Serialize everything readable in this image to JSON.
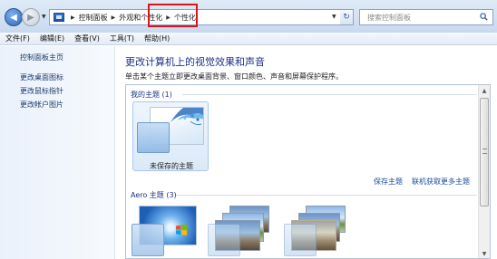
{
  "addressbar": {
    "crumbs": [
      "控制面板",
      "外观和个性化",
      "个性化"
    ],
    "search_placeholder": "搜索控制面板"
  },
  "menu": [
    "文件(F)",
    "编辑(E)",
    "查看(V)",
    "工具(T)",
    "帮助(H)"
  ],
  "leftnav": {
    "home": "控制面板主页",
    "links": [
      "更改桌面图标",
      "更改鼠标指针",
      "更改帐户图片"
    ]
  },
  "main": {
    "title": "更改计算机上的视觉效果和声音",
    "subtitle": "单击某个主题立即更改桌面背景、窗口颜色、声音和屏幕保护程序。",
    "my_themes": {
      "header": "我的主题 (1)",
      "items": [
        {
          "label": "未保存的主题"
        }
      ]
    },
    "actions": {
      "save_theme": "保存主题",
      "get_more": "联机获取更多主题"
    },
    "aero_themes": {
      "header": "Aero 主题 (3)"
    }
  },
  "colors": {
    "highlight": "#e0141c",
    "title": "#1e3287",
    "link": "#1d4c9a"
  }
}
